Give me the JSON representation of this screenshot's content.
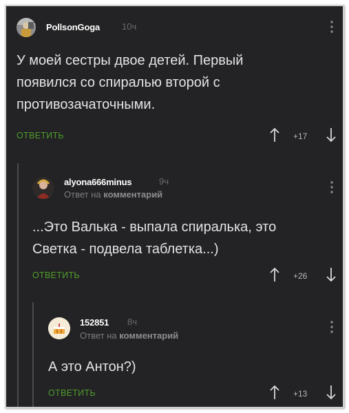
{
  "comments": [
    {
      "username": "PollsonGoga",
      "time": "10ч",
      "subline": "",
      "text_lines": [
        "У моей сестры двое детей. Первый",
        "появился со спиралью второй с",
        "противозачаточными."
      ],
      "reply_label": "ОТВЕТИТЬ",
      "score": "+17",
      "avatar_icon": "person-photo-avatar"
    },
    {
      "username": "alyona666minus",
      "time": "9ч",
      "subline_prefix": "Ответ на",
      "subline_link": "комментарий",
      "text_lines": [
        "...Это Валька - выпала спиралька, это",
        "Светка - подвела таблетка...)"
      ],
      "reply_label": "ОТВЕТИТЬ",
      "score": "+26",
      "avatar_icon": "woman-photo-avatar"
    },
    {
      "username": "152851",
      "time": "8ч",
      "subline_prefix": "Ответ на",
      "subline_link": "комментарий",
      "text_lines": [
        "А это Антон?)"
      ],
      "reply_label": "ОТВЕТИТЬ",
      "score": "+13",
      "avatar_icon": "cake-avatar"
    }
  ],
  "colors": {
    "background": "#232325",
    "reply_green": "#4f9d2a",
    "text": "#e4e4e6",
    "muted": "#7d7d80"
  }
}
